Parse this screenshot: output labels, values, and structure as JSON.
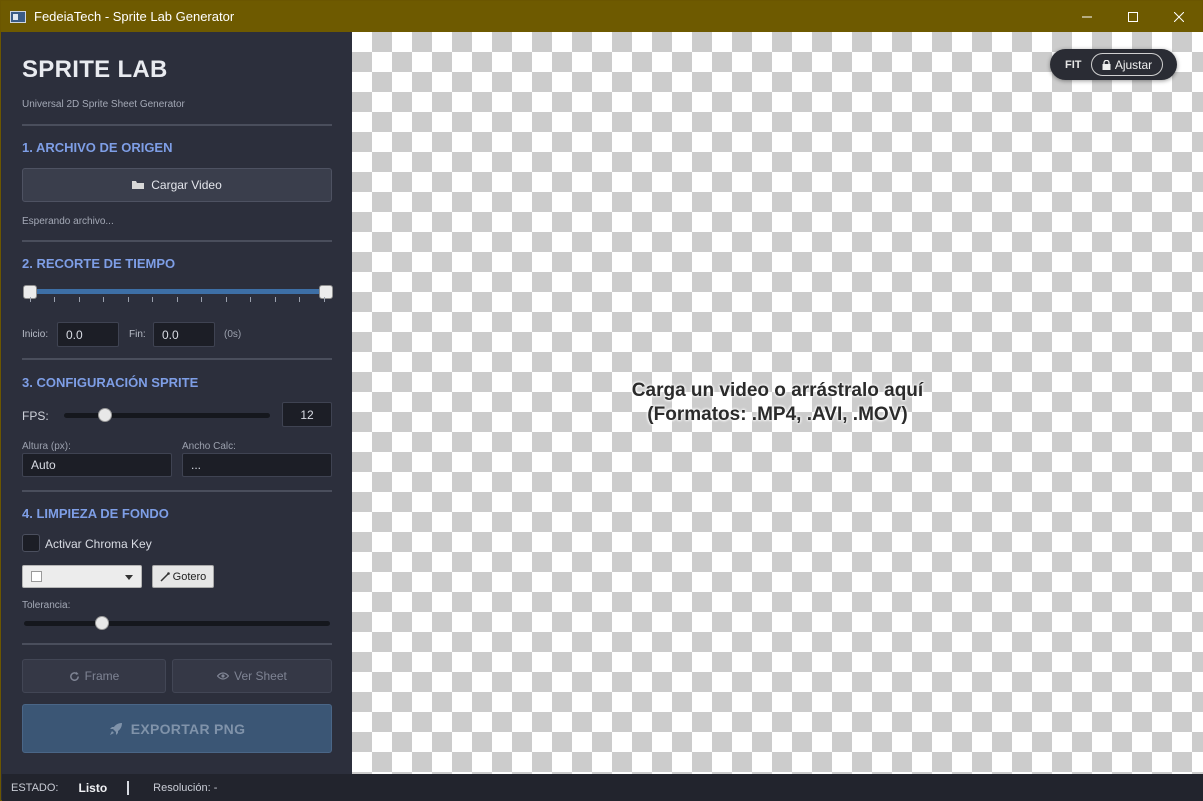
{
  "window": {
    "title": "FedeiaTech - Sprite Lab Generator"
  },
  "sidebar": {
    "title": "SPRITE LAB",
    "subtitle": "Universal 2D Sprite Sheet Generator",
    "section1": {
      "heading": "1. ARCHIVO DE ORIGEN",
      "load_button": "Cargar Video",
      "status": "Esperando archivo..."
    },
    "section2": {
      "heading": "2. RECORTE DE TIEMPO",
      "start_label": "Inicio:",
      "start_value": "0.0",
      "end_label": "Fin:",
      "end_value": "0.0",
      "duration": "(0s)"
    },
    "section3": {
      "heading": "3. CONFIGURACIÓN SPRITE",
      "fps_label": "FPS:",
      "fps_value": "12",
      "height_label": "Altura (px):",
      "height_value": "Auto",
      "width_label": "Ancho Calc:",
      "width_value": "..."
    },
    "section4": {
      "heading": "4. LIMPIEZA DE FONDO",
      "chroma_label": "Activar Chroma Key",
      "chroma_checked": false,
      "picker_button": "Gotero",
      "tolerance_label": "Tolerancia:"
    },
    "actions": {
      "frame_button": "Frame",
      "sheet_button": "Ver Sheet",
      "export_button": "EXPORTAR PNG"
    }
  },
  "canvas": {
    "message_line1": "Carga un video o arrástralo aquí",
    "message_line2": "(Formatos: .MP4, .AVI, .MOV)",
    "zoom_fit_label": "FIT",
    "zoom_adjust_label": "Ajustar"
  },
  "statusbar": {
    "state_label": "ESTADO:",
    "state_value": "Listo",
    "resolution": "Resolución: -"
  },
  "colors": {
    "titlebar": "#6e5a00",
    "sidebar_bg": "#2c2f3c",
    "section_heading": "#7e9ee6",
    "accent": "#3d6fa6"
  }
}
